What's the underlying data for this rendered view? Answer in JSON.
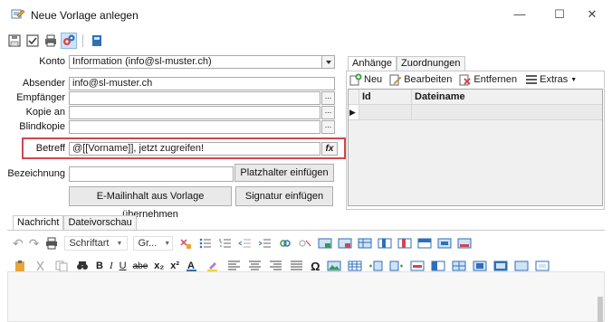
{
  "window": {
    "title": "Neue Vorlage anlegen",
    "minimize_glyph": "—",
    "maximize_glyph": "☐",
    "close_glyph": "✕"
  },
  "toolbar_top": {
    "icons": [
      "save-icon",
      "checklist-icon",
      "print-icon",
      "settings-gear-icon",
      "book-icon"
    ]
  },
  "form": {
    "konto_label": "Konto",
    "konto_value": "Information (info@sl-muster.ch)",
    "absender_label": "Absender",
    "absender_value": "info@sl-muster.ch",
    "empfaenger_label": "Empfänger",
    "empfaenger_value": "",
    "kopie_label": "Kopie an",
    "kopie_value": "",
    "blindkopie_label": "Blindkopie",
    "blindkopie_value": "",
    "betreff_label": "Betreff",
    "betreff_value": "@[[Vorname]], jetzt zugreifen!",
    "betreff_fx": "fx",
    "bezeichnung_label": "Bezeichnung",
    "bezeichnung_value": "",
    "dots": "...",
    "placeholder_button": "Platzhalter einfügen",
    "email_content_button": "E-Mailinhalt aus Vorlage übernehmen",
    "signature_button": "Signatur einfügen"
  },
  "right_panel": {
    "tabs": [
      "Anhänge",
      "Zuordnungen"
    ],
    "toolbar": {
      "neu": "Neu",
      "bearbeiten": "Bearbeiten",
      "entfernen": "Entfernen",
      "extras": "Extras"
    },
    "columns": [
      "Id",
      "Dateiname"
    ],
    "row_marker": "▶"
  },
  "editor": {
    "tabs": [
      "Nachricht",
      "Dateivorschau"
    ],
    "font_family": "Schriftart",
    "font_size": "Gr...",
    "bold": "B",
    "italic": "I",
    "underline": "U",
    "strike": "abe",
    "subscript": "x₂",
    "superscript": "x²",
    "omega": "Ω",
    "accent_colors": {
      "blue": "#2f6fb8",
      "green": "#3a9a44",
      "red": "#d0474f",
      "orange": "#e8a53a"
    }
  }
}
